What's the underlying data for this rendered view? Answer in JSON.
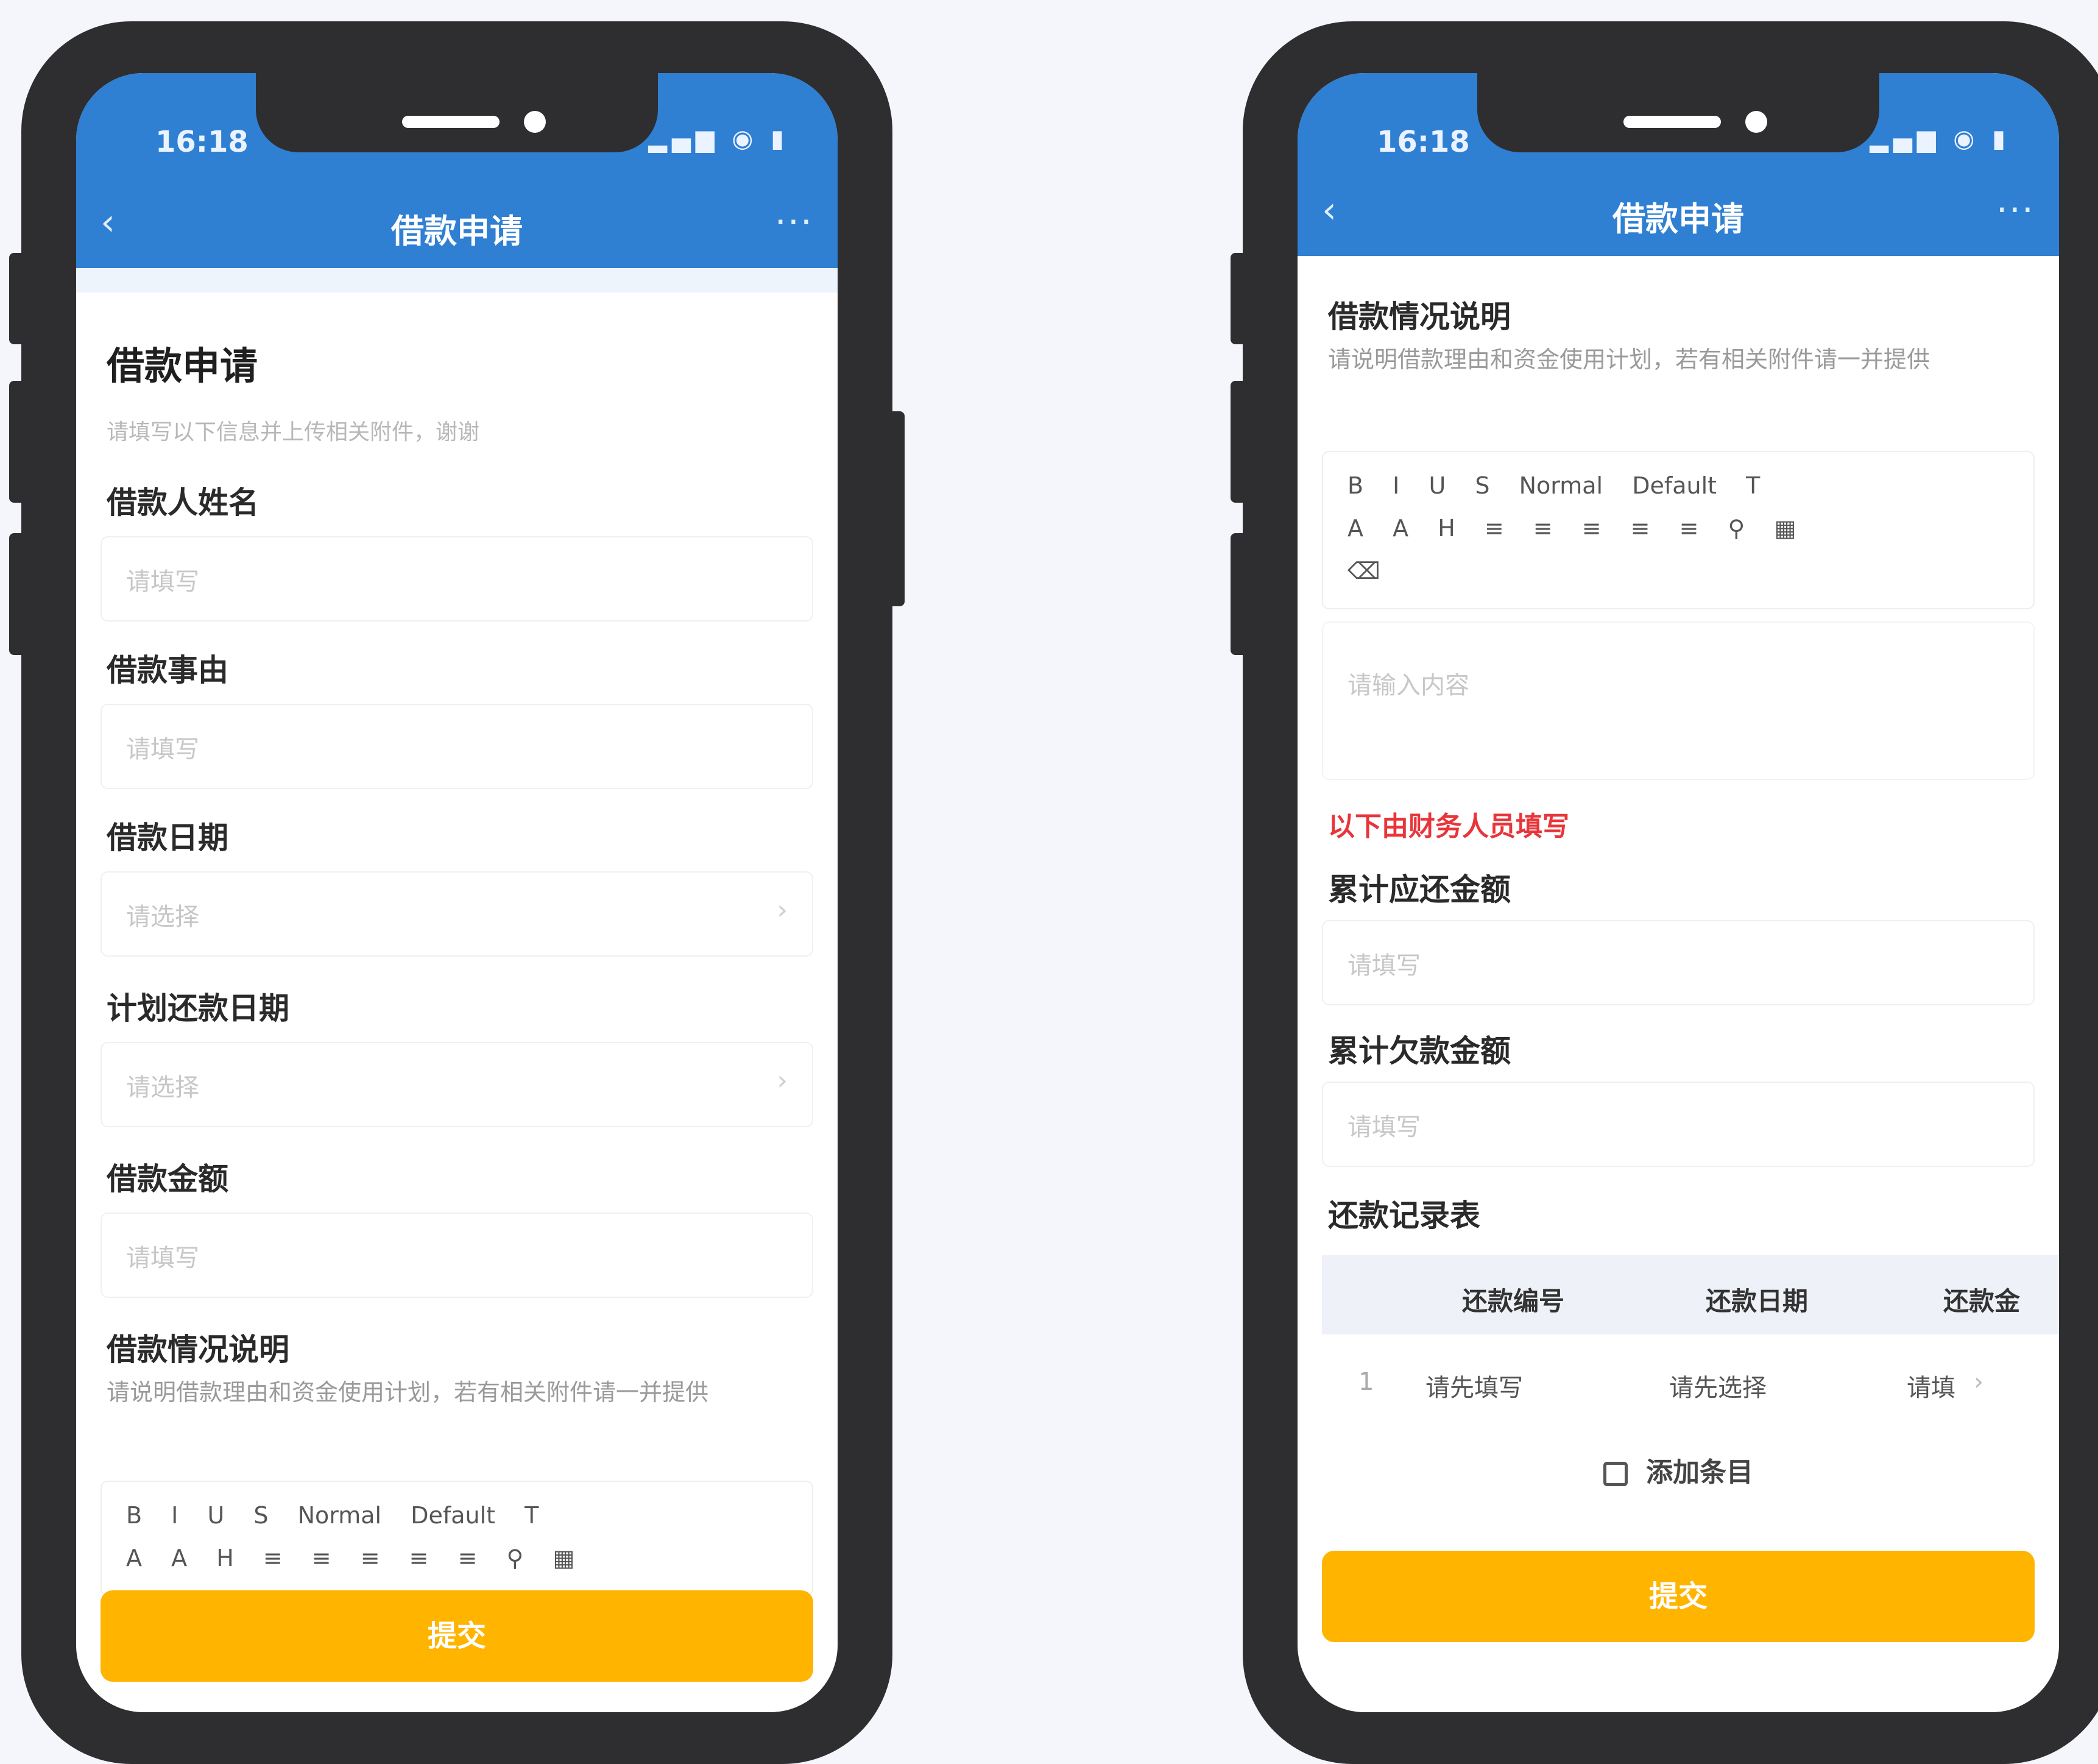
{
  "left_phone": {
    "status_time": "16:18",
    "status_icons": "▂▄▆ ◉ ▮",
    "nav": {
      "back": "‹",
      "title": "借款申请",
      "more": "···"
    },
    "form": {
      "title": "借款申请",
      "subtitle": "请填写以下信息并上传相关附件，谢谢",
      "fields": [
        {
          "label": "借款人姓名",
          "placeholder": "请填写"
        },
        {
          "label": "借款事由",
          "placeholder": "请填写"
        },
        {
          "label": "借款日期",
          "placeholder": "请选择",
          "chevron": "›"
        },
        {
          "label": "计划还款日期",
          "placeholder": "请选择",
          "chevron": "›"
        },
        {
          "label": "借款金额",
          "placeholder": "请填写"
        }
      ],
      "detail_label": "借款情况说明",
      "detail_hint": "请说明借款理由和资金使用计划，若有相关附件请一并提供"
    },
    "toolbar_row1": [
      "B",
      "I",
      "U",
      "S",
      "Normal",
      "Default",
      "T"
    ],
    "toolbar_row2": [
      "A",
      "A",
      "H",
      "≡",
      "≡",
      "≡",
      "≡",
      "≡",
      "⚲",
      "▦"
    ],
    "submit_label": "提交"
  },
  "right_phone": {
    "status_time": "16:18",
    "status_icons": "▂▄▆ ◉ ▮",
    "nav": {
      "back": "‹",
      "title": "借款申请",
      "more": "···"
    },
    "detail_label": "借款情况说明",
    "detail_hint": "请说明借款理由和资金使用计划，若有相关附件请一并提供",
    "toolbar_row1": [
      "B",
      "I",
      "U",
      "S",
      "Normal",
      "Default",
      "T"
    ],
    "toolbar_row2": [
      "A",
      "A",
      "H",
      "≡",
      "≡",
      "≡",
      "≡",
      "≡",
      "⚲",
      "▦"
    ],
    "toolbar_row3": [
      "⌫"
    ],
    "editor_placeholder": "请输入内容",
    "red_note": "以下由财务人员填写",
    "fields": [
      {
        "label": "累计应还金额",
        "placeholder": "请填写"
      },
      {
        "label": "累计欠款金额",
        "placeholder": "请填写"
      }
    ],
    "repayment": {
      "label": "还款记录表",
      "headers": [
        "还款编号",
        "还款日期",
        "还款金"
      ],
      "rows": [
        {
          "index": "1",
          "cells": [
            "请先填写",
            "请先选择",
            "请填"
          ],
          "chevron": "›"
        }
      ],
      "add_label": "添加条目"
    },
    "submit_label": "提交"
  },
  "colors": {
    "primary": "#2f7fd3",
    "accent": "#ffb400",
    "warning_text": "#e8353a",
    "background": "#f4f6fb"
  }
}
